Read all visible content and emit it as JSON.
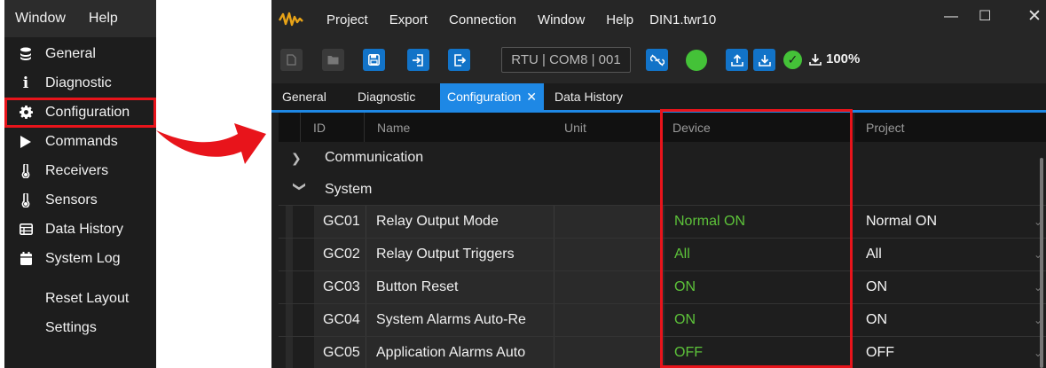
{
  "left_menu": {
    "menubar": [
      "Window",
      "Help"
    ],
    "items": [
      {
        "label": "General",
        "icon": "stack-icon"
      },
      {
        "label": "Diagnostic",
        "icon": "info-icon"
      },
      {
        "label": "Configuration",
        "icon": "gear-icon"
      },
      {
        "label": "Commands",
        "icon": "play-icon"
      },
      {
        "label": "Receivers",
        "icon": "thermometer-icon"
      },
      {
        "label": "Sensors",
        "icon": "thermometer-icon"
      },
      {
        "label": "Data History",
        "icon": "table-icon"
      },
      {
        "label": "System Log",
        "icon": "calendar-icon"
      }
    ],
    "extra_items": [
      "Reset Layout",
      "Settings"
    ]
  },
  "app": {
    "menu": [
      "Project",
      "Export",
      "Connection",
      "Window",
      "Help"
    ],
    "filename": "DIN1.twr10",
    "connection_label": "RTU | COM8 | 001",
    "progress": "100%",
    "tabs": [
      "General",
      "Diagnostic",
      "Configuration",
      "Data History"
    ],
    "active_tab": "Configuration"
  },
  "grid": {
    "columns": [
      "ID",
      "Name",
      "Unit",
      "Device",
      "Project"
    ],
    "groups": [
      "Communication",
      "System"
    ],
    "rows": [
      {
        "id": "GC01",
        "name": "Relay Output Mode",
        "unit": "",
        "device": "Normal ON",
        "project": "Normal ON"
      },
      {
        "id": "GC02",
        "name": "Relay Output Triggers",
        "unit": "",
        "device": "All",
        "project": "All"
      },
      {
        "id": "GC03",
        "name": "Button Reset",
        "unit": "",
        "device": "ON",
        "project": "ON"
      },
      {
        "id": "GC04",
        "name": "System Alarms Auto-Re",
        "unit": "",
        "device": "ON",
        "project": "ON"
      },
      {
        "id": "GC05",
        "name": "Application Alarms Auto",
        "unit": "",
        "device": "OFF",
        "project": "OFF"
      }
    ]
  },
  "colors": {
    "highlight": "#e8141b",
    "accent": "#1e88e5",
    "device_value": "#5dc33a",
    "status_ok": "#44c238"
  }
}
